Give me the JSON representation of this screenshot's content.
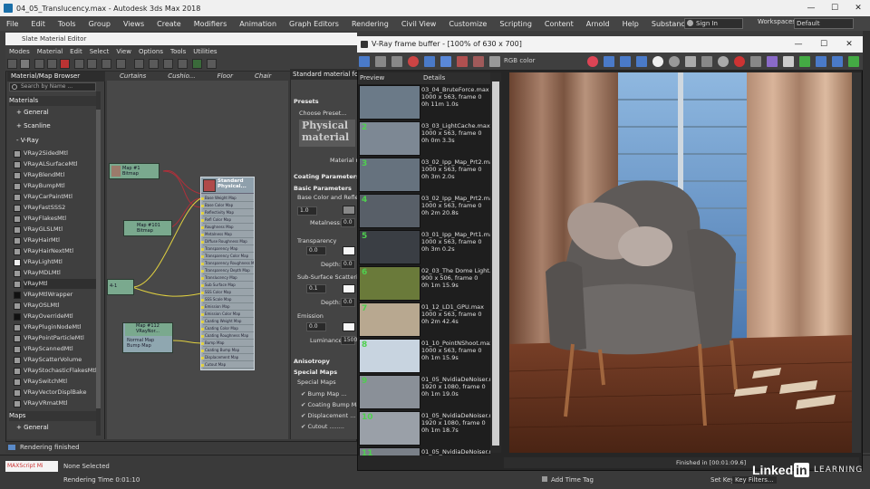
{
  "app": {
    "title": "04_05_Translucency.max - Autodesk 3ds Max 2018",
    "menu": [
      "File",
      "Edit",
      "Tools",
      "Group",
      "Views",
      "Create",
      "Modifiers",
      "Animation",
      "Graph Editors",
      "Rendering",
      "Civil View",
      "Customize",
      "Scripting",
      "Content",
      "Arnold",
      "Help",
      "Substance"
    ],
    "signin": "Sign In",
    "workspaces_label": "Workspaces:",
    "workspaces_value": "Default"
  },
  "sme": {
    "title": "Slate Material Editor",
    "menu": [
      "Modes",
      "Material",
      "Edit",
      "Select",
      "View",
      "Options",
      "Tools",
      "Utilities"
    ],
    "browser": {
      "title": "Material/Map Browser",
      "search_placeholder": "Search by Name ...",
      "sections": [
        "Materials",
        "+ General",
        "+ Scanline",
        "- V-Ray",
        "Maps",
        "+ General"
      ],
      "vray_items": [
        "VRay2SidedMtl",
        "VRayALSurfaceMtl",
        "VRayBlendMtl",
        "VRayBumpMtl",
        "VRayCarPaintMtl",
        "VRayFastSSS2",
        "VRayFlakesMtl",
        "VRayGLSLMtl",
        "VRayHairMtl",
        "VRayHairNextMtl",
        "VRayLightMtl",
        "VRayMDLMtl",
        "VRayMtl",
        "VRayMtlWrapper",
        "VRayOSLMtl",
        "VRayOverrideMtl",
        "VRayPluginNodeMtl",
        "VRayPointParticleMtl",
        "VRayScannedMtl",
        "VRayScatterVolume",
        "VRayStochasticFlakesMtl",
        "VRaySwitchMtl",
        "VRayVectorDisplBake",
        "VRayVRmatMtl"
      ]
    },
    "view_tabs": [
      "Curtains",
      "Cushio...",
      "Floor",
      "Chair"
    ],
    "nodes": {
      "n1": "Map #1\nBitmap",
      "n2": "Map #101\nBitmap",
      "n3": "Map #112\nVRayNor...",
      "n3b": "Normal Map\nBump Map",
      "n4": "4-1",
      "big_title": "Standard\nPhysical...",
      "big_slots": [
        "Base Weight Map",
        "Base Color Map",
        "Reflectivity Map",
        "Refl Color Map",
        "Roughness Map",
        "Metalness Map",
        "Diffuse Roughness Map",
        "Transparency Map",
        "Transparency Color Map",
        "Transparency Roughness Map",
        "Transparency Depth Map",
        "Translucency Map",
        "Sub Surface Map",
        "SSS Color Map",
        "SSS Scale Map",
        "Emission Map",
        "Emission Color Map",
        "Coating Weight Map",
        "Coating Color Map",
        "Coating Roughness Map",
        "Bump Map",
        "Coating Bump Map",
        "Displacement Map",
        "Cutout Map"
      ]
    },
    "params": {
      "header": "Standard material for...",
      "presets": "Presets",
      "choose_preset": "Choose Preset...",
      "material_mode": "Material m",
      "coating_params": "Coating Parameters",
      "basic_params": "Basic Parameters",
      "base_color": "Base Color and Reflect",
      "base_val": "1.0",
      "metalness_label": "Metalness:",
      "metalness_val": "0.0",
      "transparency": "Transparency",
      "transp_val": "0.0",
      "depth_label": "Depth:",
      "depth_val": "0.0",
      "sss": "Sub-Surface Scattering",
      "sss_val": "0.1",
      "sss_depth_val": "0.0",
      "emission": "Emission",
      "emission_val": "0.0",
      "luminance_label": "Luminance:",
      "luminance_val": "1500",
      "anisotropy": "Anisotropy",
      "special_maps": "Special Maps",
      "special_maps_sub": "Special Maps",
      "bump": "Bump Map ...",
      "coating_bump": "Coating Bump Map",
      "displacement": "Displacement ...",
      "cutout": "Cutout ........",
      "physical_logo": "Physical\nmaterial"
    },
    "status": "Rendering finished"
  },
  "bottom": {
    "maxscript": "MAXScript Mi",
    "none_selected": "None Selected",
    "rendering_time": "Rendering Time  0:01:10",
    "add_time_tag": "Add Time Tag",
    "set_key": "Set Key",
    "key_filters": "Key Filters..."
  },
  "vfb": {
    "title": "V-Ray frame buffer - [100% of 630 x 700]",
    "color_mode": "RGB color",
    "history_preview": "Preview",
    "history_details": "Details",
    "status": "Finished in [00:01:09.6]",
    "history": [
      {
        "name": "03_04_BruteForce.max",
        "res": "1000 x 563, frame 0",
        "time": "0h 11m 1.0s",
        "num": "",
        "thumb": "#6b7a88"
      },
      {
        "name": "03_03_LightCache.max",
        "res": "1000 x 563, frame 0",
        "time": "0h 0m 3.3s",
        "num": "2",
        "thumb": "#7d8894"
      },
      {
        "name": "03_02_Ipp_Map_Prt2.max",
        "res": "1000 x 563, frame 0",
        "time": "0h 3m 2.0s",
        "num": "3",
        "thumb": "#66727e"
      },
      {
        "name": "03_02_Ipp_Map_Prt2.max",
        "res": "1000 x 563, frame 0",
        "time": "0h 2m 20.8s",
        "num": "4",
        "thumb": "#585f68"
      },
      {
        "name": "03_01_Ipp_Map_Prt1.max",
        "res": "1000 x 563, frame 0",
        "time": "0h 3m 0.2s",
        "num": "5",
        "thumb": "#3a3e44"
      },
      {
        "name": "02_03_The Dome Light.max",
        "res": "900 x 506, frame 0",
        "time": "0h 1m 15.9s",
        "num": "6",
        "thumb": "#6a7a3a"
      },
      {
        "name": "01_12_LD1_GPU.max",
        "res": "1000 x 563, frame 0",
        "time": "0h 2m 42.4s",
        "num": "7",
        "thumb": "#b8a890"
      },
      {
        "name": "01_10_PointNShoot.max",
        "res": "1000 x 563, frame 0",
        "time": "0h 1m 15.9s",
        "num": "8",
        "thumb": "#c8d4e0"
      },
      {
        "name": "01_05_NvidiaDeNoiser.max",
        "res": "1920 x 1080, frame 0",
        "time": "0h 1m 19.0s",
        "num": "9",
        "thumb": "#8a9098"
      },
      {
        "name": "01_05_NvidiaDeNoiser.max",
        "res": "1920 x 1080, frame 0",
        "time": "0h 1m 18.7s",
        "num": "10",
        "thumb": "#9aa0a8"
      },
      {
        "name": "01_05_NvidiaDeNoiser.max",
        "res": "1920 x 1080, frame 0",
        "time": "0h 1m 17.7s",
        "num": "11",
        "thumb": "#7a8088"
      }
    ]
  },
  "watermark": {
    "linkedin": "Linked",
    "in": "in",
    "learning": "LEARNING"
  }
}
